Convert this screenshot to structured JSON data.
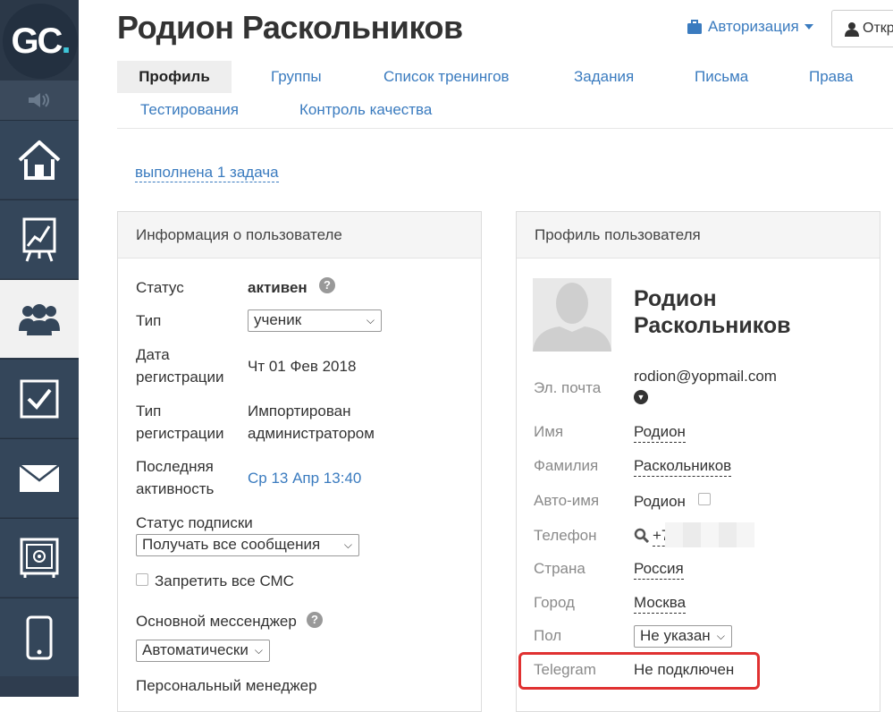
{
  "sidebar": {
    "logo_main": "GC",
    "logo_dot": ".",
    "items": [
      {
        "icon": "home-icon"
      },
      {
        "icon": "chart-icon"
      },
      {
        "icon": "users-icon",
        "active": true
      },
      {
        "icon": "checkbox-icon"
      },
      {
        "icon": "mail-icon"
      },
      {
        "icon": "safe-icon"
      },
      {
        "icon": "phone-icon"
      }
    ]
  },
  "header": {
    "title": "Родион Раскольников",
    "auth_label": "Авторизация",
    "open_label": "Откр"
  },
  "tabs": [
    {
      "label": "Профиль",
      "active": true
    },
    {
      "label": "Группы"
    },
    {
      "label": "Список тренингов"
    },
    {
      "label": "Задания"
    },
    {
      "label": "Письма"
    },
    {
      "label": "Права"
    },
    {
      "label": "Тестирования"
    },
    {
      "label": "Контроль качества"
    }
  ],
  "task_link": "выполнена 1 задача",
  "user_info": {
    "title": "Информация о пользователе",
    "status_label": "Статус",
    "status_value": "активен",
    "help": "?",
    "type_label": "Тип",
    "type_value": "ученик",
    "reg_date_label_1": "Дата",
    "reg_date_label_2": "регистрации",
    "reg_date_value": "Чт 01 Фев 2018",
    "reg_type_label_1": "Тип",
    "reg_type_label_2": "регистрации",
    "reg_type_value_1": "Импортирован",
    "reg_type_value_2": "администратором",
    "last_active_label_1": "Последняя",
    "last_active_label_2": "активность",
    "last_active_value": "Ср 13 Апр 13:40",
    "subscription_label": "Статус подписки",
    "subscription_value": "Получать все сообщения",
    "sms_label": "Запретить все СМС",
    "messenger_label": "Основной мессенджер",
    "messenger_value": "Автоматически",
    "manager_label": "Персональный менеджер"
  },
  "profile": {
    "title": "Профиль пользователя",
    "name_line_1": "Родион",
    "name_line_2": "Раскольников",
    "email_label": "Эл. почта",
    "email_value": "rodion@yopmail.com",
    "first_name_label": "Имя",
    "first_name_value": "Родион",
    "last_name_label": "Фамилия",
    "last_name_value": "Раскольников",
    "auto_name_label": "Авто-имя",
    "auto_name_value": "Родион",
    "phone_label": "Телефон",
    "phone_value": "+7",
    "country_label": "Страна",
    "country_value": "Россия",
    "city_label": "Город",
    "city_value": "Москва",
    "gender_label": "Пол",
    "gender_value": "Не указан",
    "telegram_label": "Telegram",
    "telegram_value": "Не подключен"
  }
}
